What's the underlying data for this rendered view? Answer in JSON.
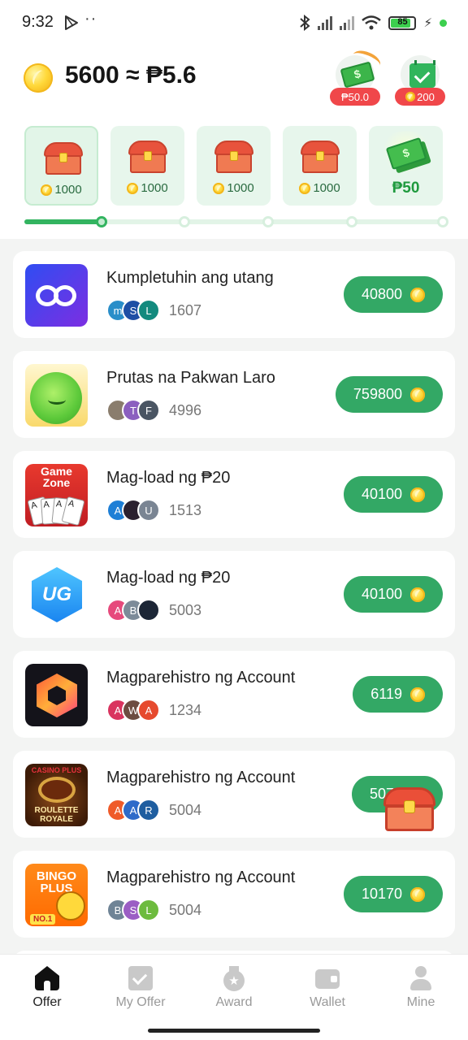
{
  "status_bar": {
    "time": "9:32",
    "dots": "··",
    "battery": "85"
  },
  "header": {
    "balance": "5600 ≈ ₱5.6",
    "cash_badge": "₱50.0",
    "checkin_badge": "200"
  },
  "chests": [
    {
      "amount": "1000"
    },
    {
      "amount": "1000"
    },
    {
      "amount": "1000"
    },
    {
      "amount": "1000"
    }
  ],
  "cash_reward": "₱50",
  "progress": {
    "fraction": 0.18,
    "steps": 5,
    "current_step": 1
  },
  "offers": [
    {
      "title": "Kumpletuhin ang utang",
      "reward": "40800",
      "count": "1607",
      "avatars": [
        {
          "t": "m",
          "c": "#2a8ec9"
        },
        {
          "t": "S",
          "c": "#1e4fa5"
        },
        {
          "t": "L",
          "c": "#138a7e"
        }
      ]
    },
    {
      "title": "Prutas na Pakwan Laro",
      "reward": "759800",
      "count": "4996",
      "avatars": [
        {
          "t": "",
          "c": "#8a7d6d"
        },
        {
          "t": "T",
          "c": "#8b5fbf"
        },
        {
          "t": "F",
          "c": "#4a5563"
        }
      ]
    },
    {
      "title": "Mag-load ng ₱20",
      "reward": "40100",
      "count": "1513",
      "avatars": [
        {
          "t": "A",
          "c": "#1e7fd6"
        },
        {
          "t": "",
          "c": "#2b2130"
        },
        {
          "t": "U",
          "c": "#7a8593"
        }
      ]
    },
    {
      "title": "Mag-load ng ₱20",
      "reward": "40100",
      "count": "5003",
      "avatars": [
        {
          "t": "A",
          "c": "#e64a7c"
        },
        {
          "t": "B",
          "c": "#7d8b99"
        },
        {
          "t": "",
          "c": "#1c2636"
        }
      ]
    },
    {
      "title": "Magparehistro ng Account",
      "reward": "6119",
      "count": "1234",
      "avatars": [
        {
          "t": "A",
          "c": "#d9345f"
        },
        {
          "t": "W",
          "c": "#6d4c41"
        },
        {
          "t": "A",
          "c": "#e64a2e"
        }
      ]
    },
    {
      "title": "Magparehistro ng Account",
      "reward": "5070",
      "count": "5004",
      "avatars": [
        {
          "t": "A",
          "c": "#ef5b2a"
        },
        {
          "t": "A",
          "c": "#2e6bc9"
        },
        {
          "t": "R",
          "c": "#1f5ea0"
        }
      ]
    },
    {
      "title": "Magparehistro ng Account",
      "reward": "10170",
      "count": "5004",
      "avatars": [
        {
          "t": "B",
          "c": "#6f8496"
        },
        {
          "t": "S",
          "c": "#9b5ec4"
        },
        {
          "t": "L",
          "c": "#6dbb3e"
        }
      ]
    }
  ],
  "nav": [
    {
      "label": "Offer",
      "icon": "home-icon",
      "active": true
    },
    {
      "label": "My Offer",
      "icon": "document-check-icon",
      "active": false
    },
    {
      "label": "Award",
      "icon": "medal-icon",
      "active": false
    },
    {
      "label": "Wallet",
      "icon": "wallet-icon",
      "active": false
    },
    {
      "label": "Mine",
      "icon": "user-icon",
      "active": false
    }
  ],
  "colors": {
    "accent": "#33a865",
    "badge_red": "#f0474a",
    "card_bg": "#e7f6ec"
  }
}
